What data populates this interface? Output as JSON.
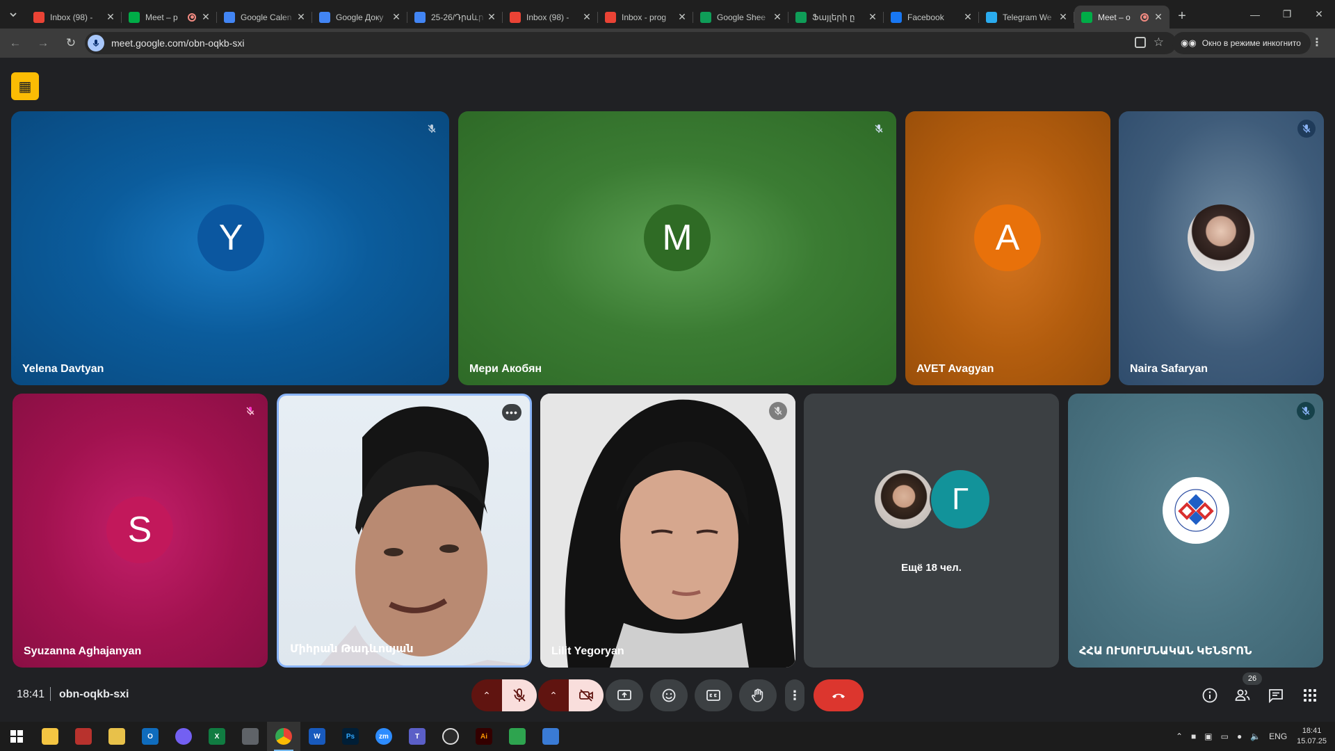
{
  "browser": {
    "tabs": [
      {
        "title": "Inbox (98) - ",
        "icon": "gmail-icon",
        "color": "#ea4335",
        "active": false
      },
      {
        "title": "Meet – p",
        "icon": "meet-icon",
        "color": "#00ac47",
        "active": false,
        "recording": true
      },
      {
        "title": "Google Calen",
        "icon": "calendar-icon",
        "color": "#4285f4",
        "active": false
      },
      {
        "title": "Google Доку",
        "icon": "docs-icon",
        "color": "#4285f4",
        "active": false
      },
      {
        "title": "25-26/Դրսևր",
        "icon": "docs-icon",
        "color": "#4285f4",
        "active": false
      },
      {
        "title": "Inbox (98) - ",
        "icon": "gmail-icon",
        "color": "#ea4335",
        "active": false
      },
      {
        "title": "Inbox - prog",
        "icon": "gmail-icon",
        "color": "#ea4335",
        "active": false
      },
      {
        "title": "Google Shee",
        "icon": "sheets-icon",
        "color": "#0f9d58",
        "active": false
      },
      {
        "title": "Ֆայլերի ը",
        "icon": "sheets-icon",
        "color": "#0f9d58",
        "active": false
      },
      {
        "title": "Facebook",
        "icon": "facebook-icon",
        "color": "#1877f2",
        "active": false
      },
      {
        "title": "Telegram We",
        "icon": "telegram-icon",
        "color": "#2aabee",
        "active": false
      },
      {
        "title": "Meet – o",
        "icon": "meet-icon",
        "color": "#00ac47",
        "active": true,
        "recording": true
      }
    ],
    "url": "meet.google.com/obn-oqkb-sxi",
    "incognito_label": "Окно в режиме инкогнито"
  },
  "participants": [
    {
      "name": "Yelena Davtyan",
      "initial": "Y",
      "avatar_color": "#0b57a0",
      "muted": true
    },
    {
      "name": "Мери Акобян",
      "initial": "M",
      "avatar_color": "#2f6b25",
      "muted": true
    },
    {
      "name": "AVET Avagyan",
      "initial": "A",
      "avatar_color": "#e8710a",
      "muted": false
    },
    {
      "name": "Naira Safaryan",
      "initial": "",
      "avatar_color": "#d9c7c0",
      "muted": true
    },
    {
      "name": "Syuzanna Aghajanyan",
      "initial": "S",
      "avatar_color": "#c2185b",
      "muted": true
    },
    {
      "name": "Միհրան Թադևոսյան",
      "initial": "",
      "avatar_color": "#e7eef4",
      "muted": false,
      "speaking": true
    },
    {
      "name": "Lilit Yegoryan",
      "initial": "",
      "avatar_color": "#e4e4e4",
      "muted": true
    },
    {
      "name": "ՀՀԱ ՈՒՍՈՒՄՆԱԿԱՆ ԿԵՆՏՐՈՆ",
      "initial": "",
      "avatar_color": "#ffffff",
      "muted": true
    }
  ],
  "overflow": {
    "second_initial": "Г",
    "second_color": "#12939a",
    "label": "Ещё 18 чел."
  },
  "meeting": {
    "time": "18:41",
    "code": "obn-oqkb-sxi",
    "people_count": "26"
  },
  "colors": {
    "end_call": "#dc362e",
    "mic_off_bg": "#f9dedc",
    "accent_border": "#8ab4f8"
  },
  "taskbar": {
    "language": "ENG",
    "clock_time": "18:41",
    "clock_date": "15.07.25"
  }
}
